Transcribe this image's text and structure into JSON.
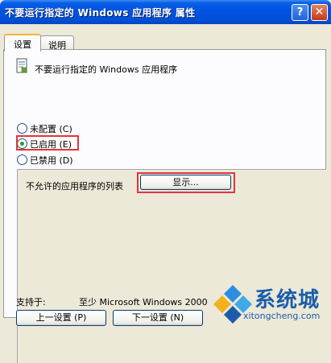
{
  "window": {
    "title": "不要运行指定的 Windows 应用程序 属性",
    "help_icon": "question-mark",
    "close_icon": "x"
  },
  "tabs": [
    {
      "label": "设置",
      "active": true
    },
    {
      "label": "说明",
      "active": false
    }
  ],
  "policy": {
    "icon": "policy-setting-icon",
    "name": "不要运行指定的 Windows 应用程序"
  },
  "state_options": [
    {
      "label": "未配置 (C)",
      "checked": false
    },
    {
      "label": "已启用 (E)",
      "checked": true
    },
    {
      "label": "已禁用 (D)",
      "checked": false
    }
  ],
  "options": {
    "list_label": "不允许的应用程序的列表",
    "show_button": "显示..."
  },
  "support": {
    "label": "支持于:",
    "value": "至少 Microsoft Windows 2000"
  },
  "nav": {
    "prev_button": "上一设置 (P)",
    "next_button": "下一设置 (N)"
  },
  "watermark": {
    "text": "系统城",
    "url": "xitongcheng.com"
  },
  "colors": {
    "highlight_border": "#E0353B",
    "titlebar": "#0054E3",
    "dialog_bg": "#ECE9D8"
  }
}
